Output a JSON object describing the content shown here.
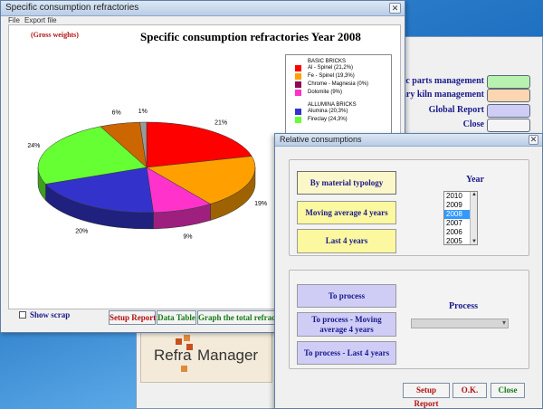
{
  "background_app": {
    "side_buttons": [
      {
        "label": "Static parts management",
        "color": "#b8f2b0"
      },
      {
        "label": "Rotary kiln management",
        "color": "#fbd6b0"
      },
      {
        "label": "Global Report",
        "color": "#cfcdf6"
      },
      {
        "label": "Close",
        "color": "#f4f4f4"
      }
    ],
    "logo": {
      "part1": "Refra",
      "part2": "Manager"
    }
  },
  "chart_window": {
    "title": "Specific consumption refractories",
    "menu": [
      "File",
      "Export file"
    ],
    "gross_weights": "(Gross weights)",
    "show_scrap_label": "Show scrap",
    "buttons": {
      "setup_report": "Setup Report",
      "data_table": "Data Table",
      "graph_total": "Graph the total refractory"
    },
    "button_colors": {
      "setup_report": "#b31212",
      "data_table": "#157a15",
      "graph_total": "#157a15"
    }
  },
  "chart_data": {
    "type": "pie",
    "title": "Specific consumption refractories Year 2008",
    "slices": [
      {
        "label": "21%",
        "value": 21,
        "color": "#ff0000"
      },
      {
        "label": "19%",
        "value": 19,
        "color": "#ffa000"
      },
      {
        "label": "9%",
        "value": 9,
        "color": "#ff33cc"
      },
      {
        "label": "20%",
        "value": 20,
        "color": "#3333cc"
      },
      {
        "label": "24%",
        "value": 24,
        "color": "#66ff33"
      },
      {
        "label": "6%",
        "value": 6,
        "color": "#cc6600"
      },
      {
        "label": "1%",
        "value": 1,
        "color": "#999999"
      }
    ],
    "legend_placement": "right",
    "legend": [
      {
        "group": "BASIC BRICKS",
        "items": [
          {
            "label": "Al - Spinel (21,2%)",
            "color": "#ff0000"
          },
          {
            "label": "Fe - Spinel (19,3%)",
            "color": "#ffa000"
          },
          {
            "label": "Chrome - Magnesia (0%)",
            "color": "#8b0a50"
          },
          {
            "label": "Dolomite (9%)",
            "color": "#ff33cc"
          }
        ]
      },
      {
        "group": "ALLUMINA BRICKS",
        "items": [
          {
            "label": "Alumina (20,3%)",
            "color": "#3333cc"
          },
          {
            "label": "Fireclay (24,3%)",
            "color": "#66ff33"
          }
        ]
      }
    ]
  },
  "relative_window": {
    "title": "Relative consumptions",
    "year_group": {
      "label": "Year",
      "buttons": [
        "By material typology",
        "Moving average 4 years",
        "Last 4 years"
      ],
      "years": [
        "2010",
        "2009",
        "2008",
        "2007",
        "2006",
        "2005"
      ],
      "selected_year": "2008"
    },
    "process_group": {
      "label": "Process",
      "buttons": [
        "To process",
        "To process - Moving average 4 years",
        "To process - Last 4 years"
      ],
      "dropdown_value": ""
    },
    "footer_buttons": [
      {
        "label": "Setup Report",
        "color": "#b31212"
      },
      {
        "label": "O.K.",
        "color": "#b31212"
      },
      {
        "label": "Close",
        "color": "#157a15"
      }
    ]
  }
}
